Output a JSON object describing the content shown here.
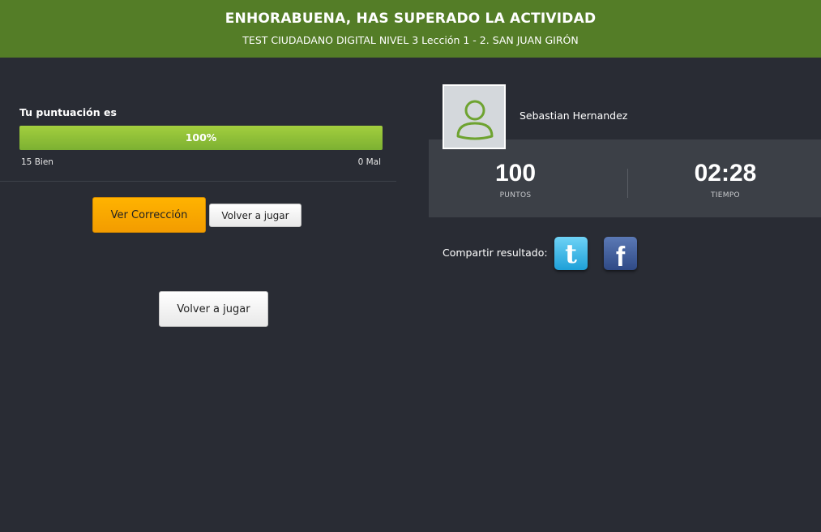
{
  "header": {
    "title": "ENHORABUENA, HAS SUPERADO LA ACTIVIDAD",
    "subtitle": "TEST CIUDADANO DIGITAL NIVEL 3 Lección 1 - 2. SAN JUAN GIRÓN"
  },
  "score": {
    "label": "Tu puntuación es",
    "percent_text": "100%",
    "percent_value": 100,
    "correct_text": "15 Bien",
    "wrong_text": "0 Mal",
    "bar_color": "#8cc33a"
  },
  "buttons": {
    "correction_label": "Ver Corrección",
    "replay_small_label": "Volver a jugar",
    "replay_large_label": "Volver a jugar"
  },
  "user": {
    "name": "Sebastian Hernandez",
    "avatar_icon": "user-icon"
  },
  "stats": {
    "points_value": "100",
    "points_label": "PUNTOS",
    "time_value": "02:28",
    "time_label": "TIEMPO"
  },
  "share": {
    "label": "Compartir resultado:",
    "twitter_icon": "twitter-icon",
    "facebook_icon": "facebook-icon"
  },
  "colors": {
    "header_bg": "#547d27",
    "page_bg": "#292c34",
    "accent_orange": "#ffb300"
  }
}
